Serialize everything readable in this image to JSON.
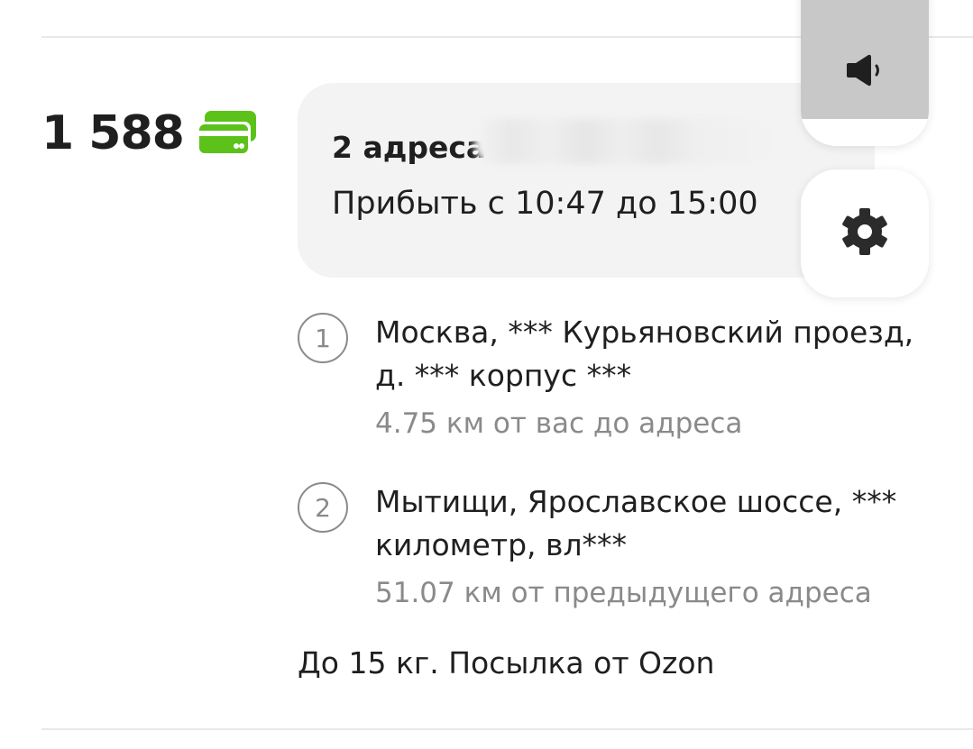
{
  "order": {
    "price": "1 588",
    "payment_icon": "card-icon",
    "payment_color": "#5cc21a"
  },
  "card": {
    "line1": "2 адреса",
    "line2": "Прибыть с 10:47 до 15:00"
  },
  "side_buttons": {
    "sound_icon": "speaker-icon",
    "settings_icon": "gear-icon"
  },
  "stops": [
    {
      "number": "1",
      "address": "Москва, *** Курьяновский проезд, д. *** корпус ***",
      "distance": "4.75 км от вас до адреса"
    },
    {
      "number": "2",
      "address": "Мытищи, Ярославское шоссе, *** километр, вл***",
      "distance": "51.07 км от предыдущего адреса"
    }
  ],
  "note": "До 15 кг. Посылка от Ozon"
}
